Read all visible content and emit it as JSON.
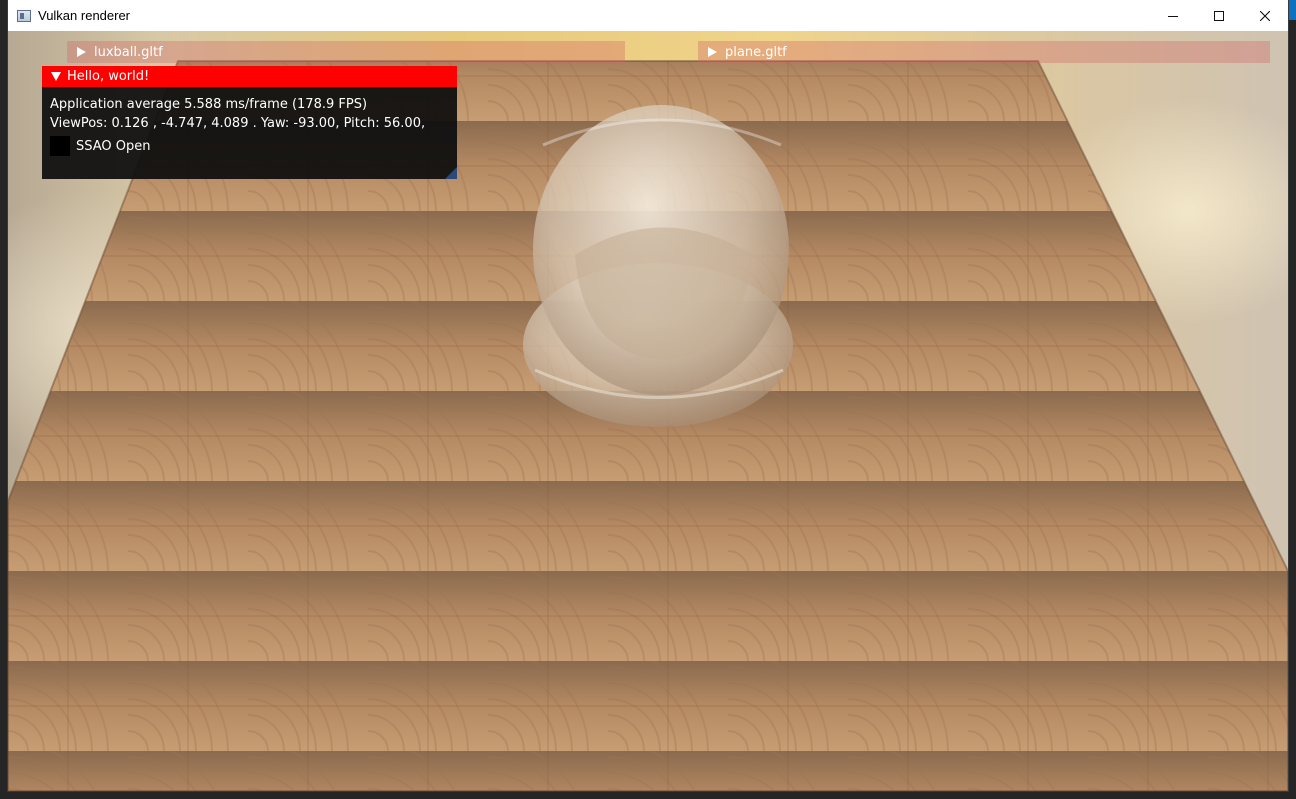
{
  "window": {
    "title": "Vulkan renderer",
    "controls": {
      "minimize_icon": "minimize-icon",
      "maximize_icon": "maximize-icon",
      "close_icon": "close-icon"
    }
  },
  "panels": {
    "luxball": {
      "label": "luxball.gltf",
      "collapsed": true
    },
    "plane": {
      "label": "plane.gltf",
      "collapsed": true
    }
  },
  "debug_window": {
    "title": "Hello, world!",
    "fps_line": "Application average 5.588 ms/frame (178.9 FPS)",
    "viewpos_line": "ViewPos:  0.126 , -4.747, 4.089 . Yaw: -93.00, Pitch: 56.00,",
    "ssao_label": "SSAO Open",
    "ssao_checked": false
  },
  "colors": {
    "title_bar_active": "#ff0000",
    "window_bg": "#0f0f0f",
    "collapsed_header": "#d26464",
    "wood_base": "#b98a5e"
  }
}
